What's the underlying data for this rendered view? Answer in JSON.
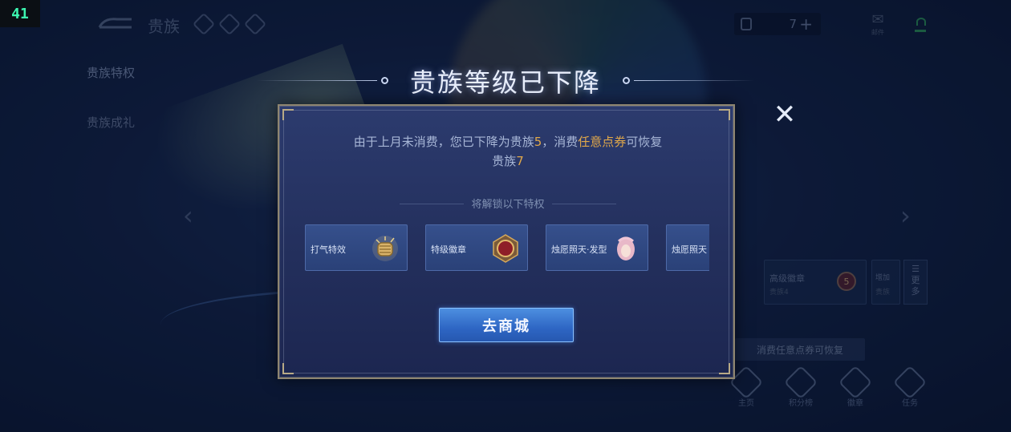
{
  "status_badge": "41",
  "topbar": {
    "page_title": "贵族",
    "currency_value": "7",
    "currency_plus": "+",
    "mail_label": "邮件"
  },
  "left_nav": {
    "items": [
      {
        "label": "贵族特权"
      },
      {
        "label": "贵族成礼"
      }
    ]
  },
  "background_panel": {
    "card_title": "高级徽章",
    "card_sub": "贵族4",
    "badge_level": "5",
    "card2_title": "增加",
    "card2_sub": "贵族",
    "more_label": "更多",
    "tip": "消费任意点券可恢复",
    "bottom_tabs": [
      {
        "label": "主页"
      },
      {
        "label": "积分榜"
      },
      {
        "label": "徽章"
      },
      {
        "label": "任务"
      }
    ]
  },
  "modal": {
    "title": "贵族等级已下降",
    "close_icon": "close-icon",
    "message_part1": "由于上月未消费，您已下降为贵族",
    "message_level_current": "5",
    "message_part2": "，消费",
    "message_highlight": "任意点券",
    "message_part3": "可恢复",
    "message_line2_prefix": "贵族",
    "message_level_restore": "7",
    "unlock_header": "将解锁以下特权",
    "perks": [
      {
        "label": "打气特效",
        "icon": "fist-icon"
      },
      {
        "label": "特级徽章",
        "icon": "medal-icon"
      },
      {
        "label": "烛愿照天·发型",
        "icon": "hairstyle-icon"
      },
      {
        "label": "烛愿照天",
        "icon": "hairstyle-icon"
      }
    ],
    "shop_button": "去商城"
  },
  "colors": {
    "highlight": "#e0a84a",
    "button": "#2e66c4",
    "badge_text": "#3cf5b0"
  }
}
